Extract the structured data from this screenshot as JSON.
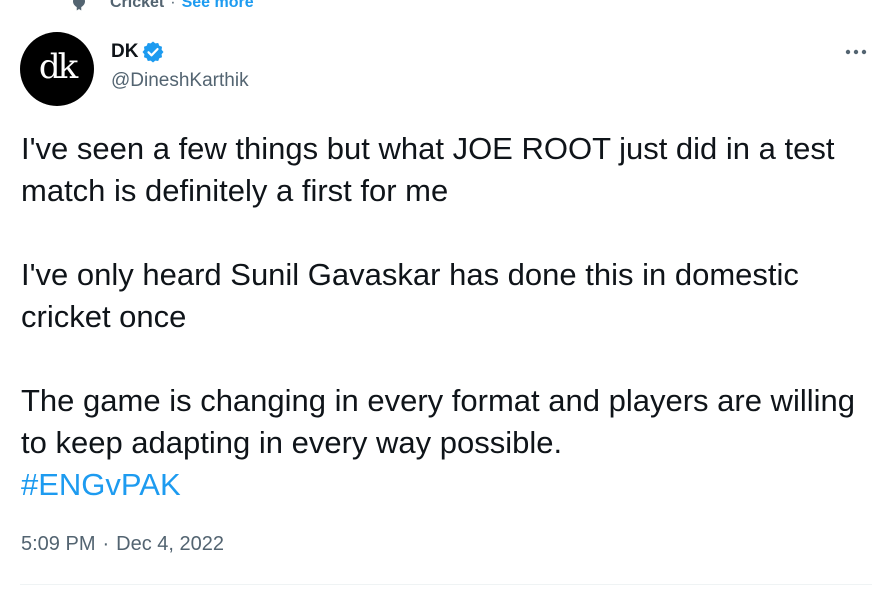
{
  "context": {
    "topic": "Cricket",
    "separator": "·",
    "see_more": "See more",
    "icon": "topic-icon"
  },
  "author": {
    "avatar_text": "dk",
    "display_name": "DK",
    "handle": "@DineshKarthik",
    "verified_icon": "verified-badge-icon",
    "verified_color": "#1d9bf0"
  },
  "more_menu_icon": "more-horizontal-icon",
  "tweet": {
    "line1": "I've seen a few things but what JOE ROOT just did in a test match is definitely a first for me",
    "line2": "I've only heard Sunil Gavaskar has done this in domestic cricket once",
    "line3": "The game is changing in every format and players are willing to keep adapting in every way possible.",
    "hashtag": "#ENGvPAK"
  },
  "meta": {
    "time": "5:09 PM",
    "separator": "·",
    "date": "Dec 4, 2022"
  },
  "colors": {
    "link": "#1d9bf0",
    "secondary_text": "#536471",
    "primary_text": "#0f1419"
  }
}
